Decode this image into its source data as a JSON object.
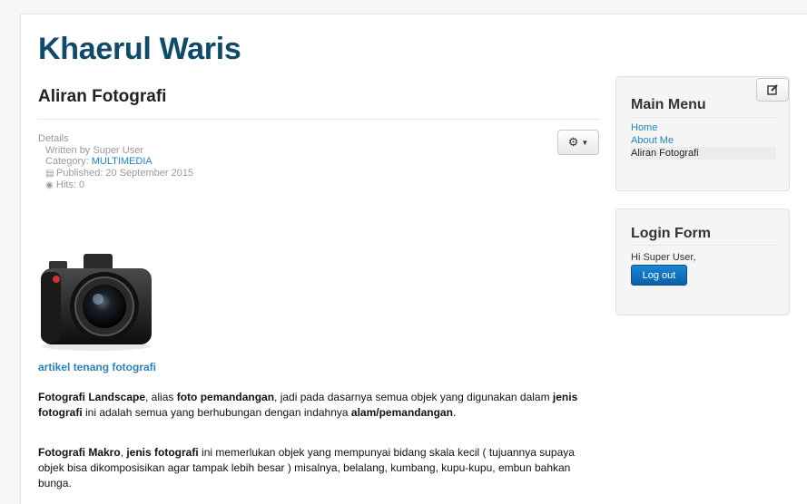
{
  "site": {
    "title": "Khaerul Waris"
  },
  "article": {
    "title": "Aliran Fotografi",
    "details_label": "Details",
    "written_by": "Written by Super User",
    "category_prefix": "Category: ",
    "category": "MULTIMEDIA",
    "published": "Published: 20 September 2015",
    "hits": "Hits: 0",
    "image_caption": "artikel tenang fotografi",
    "p1": [
      {
        "t": "Fotografi Landscape",
        "b": true
      },
      {
        "t": ", alias ",
        "b": false
      },
      {
        "t": "foto pemandangan",
        "b": true
      },
      {
        "t": ", jadi pada dasarnya semua objek yang digunakan dalam ",
        "b": false
      },
      {
        "t": "jenis fotografi",
        "b": true
      },
      {
        "t": " ini adalah semua yang berhubungan dengan indahnya ",
        "b": false
      },
      {
        "t": "alam/pemandangan",
        "b": true
      },
      {
        "t": ".",
        "b": false
      }
    ],
    "p2": [
      {
        "t": "Fotografi Makro",
        "b": true
      },
      {
        "t": ", ",
        "b": false
      },
      {
        "t": "jenis fotografi",
        "b": true
      },
      {
        "t": " ini memerlukan objek yang mempunyai bidang skala kecil ( tujuannya supaya objek bisa dikomposisikan agar tampak lebih besar ) misalnya, belalang, kumbang, kupu-kupu, embun bahkan bunga.",
        "b": false
      }
    ]
  },
  "sidebar": {
    "main_menu": {
      "title": "Main Menu",
      "items": [
        {
          "label": "Home",
          "active": false
        },
        {
          "label": "About Me",
          "active": false
        },
        {
          "label": "Aliran Fotografi",
          "active": true
        }
      ]
    },
    "login": {
      "title": "Login Form",
      "greeting": "Hi Super User,",
      "logout_label": "Log out"
    }
  },
  "icons": {
    "gear": "gear-icon",
    "edit": "edit-icon",
    "calendar": "calendar-icon",
    "eye": "eye-icon"
  },
  "colors": {
    "site_title": "#0f4a6b",
    "link": "#1f86c1",
    "button_primary": "#0b5fa8"
  }
}
